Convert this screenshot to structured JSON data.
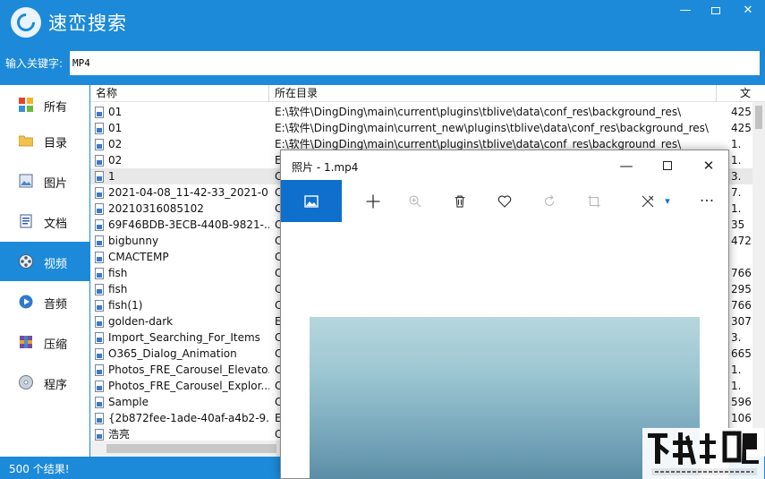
{
  "app": {
    "title": "速峦搜索",
    "window_buttons": {
      "minimize": "—",
      "close": "✕"
    }
  },
  "search": {
    "label": "输入关键字:",
    "value": "MP4"
  },
  "sidebar": {
    "items": [
      {
        "label": "所有",
        "icon": "grid-icon",
        "active": false
      },
      {
        "label": "目录",
        "icon": "folder-icon",
        "active": false
      },
      {
        "label": "图片",
        "icon": "picture-icon",
        "active": false
      },
      {
        "label": "文档",
        "icon": "document-icon",
        "active": false
      },
      {
        "label": "视频",
        "icon": "film-reel-icon",
        "active": true
      },
      {
        "label": "音频",
        "icon": "play-icon",
        "active": false
      },
      {
        "label": "压缩",
        "icon": "archive-icon",
        "active": false
      },
      {
        "label": "程序",
        "icon": "disc-icon",
        "active": false
      }
    ]
  },
  "list": {
    "columns": {
      "name": "名称",
      "dir": "所在目录",
      "size": "文"
    },
    "rows": [
      {
        "name": "01",
        "dir": "E:\\软件\\DingDing\\main\\current\\plugins\\tblive\\data\\conf_res\\background_res\\",
        "size": "425"
      },
      {
        "name": "01",
        "dir": "E:\\软件\\DingDing\\main\\current_new\\plugins\\tblive\\data\\conf_res\\background_res\\",
        "size": "425"
      },
      {
        "name": "02",
        "dir": "E:\\软件\\DingDing\\main\\current\\plugins\\tblive\\data\\conf_res\\background_res\\",
        "size": "1."
      },
      {
        "name": "02",
        "dir": "E:",
        "size": "1."
      },
      {
        "name": "1",
        "dir": "C",
        "size": "3."
      },
      {
        "name": "2021-04-08_11-42-33_2021-0...",
        "dir": "C",
        "size": "7."
      },
      {
        "name": "20210316085102",
        "dir": "C",
        "size": "1."
      },
      {
        "name": "69F46BDB-3ECB-440B-9821-...",
        "dir": "C",
        "size": "35"
      },
      {
        "name": "bigbunny",
        "dir": "C",
        "size": "472"
      },
      {
        "name": "CMACTEMP",
        "dir": "C",
        "size": ""
      },
      {
        "name": "fish",
        "dir": "C",
        "size": "766"
      },
      {
        "name": "fish",
        "dir": "C",
        "size": "295"
      },
      {
        "name": "fish(1)",
        "dir": "C",
        "size": "766"
      },
      {
        "name": "golden-dark",
        "dir": "E",
        "size": "307"
      },
      {
        "name": "Import_Searching_For_Items",
        "dir": "C",
        "size": "3."
      },
      {
        "name": "O365_Dialog_Animation",
        "dir": "C",
        "size": "665"
      },
      {
        "name": "Photos_FRE_Carousel_Elevato...",
        "dir": "C",
        "size": "1."
      },
      {
        "name": "Photos_FRE_Carousel_Explor...",
        "dir": "C",
        "size": "1."
      },
      {
        "name": "Sample",
        "dir": "C",
        "size": "596"
      },
      {
        "name": "{2b872fee-1ade-40af-a4b2-9...",
        "dir": "E",
        "size": "106"
      },
      {
        "name": "浩亮",
        "dir": "C",
        "size": "1"
      }
    ]
  },
  "status": {
    "text": "500 个结果!"
  },
  "photos_window": {
    "title": "照片 - 1.mp4",
    "buttons": {
      "minimize": "—",
      "close": "✕"
    },
    "toolbar": [
      {
        "name": "view-icon"
      },
      {
        "name": "add-icon"
      },
      {
        "name": "zoom-in-icon"
      },
      {
        "name": "delete-icon"
      },
      {
        "name": "favorite-icon"
      },
      {
        "name": "rotate-icon"
      },
      {
        "name": "crop-icon"
      },
      {
        "name": "edit-icon"
      },
      {
        "name": "more-icon"
      }
    ]
  },
  "colors": {
    "brand": "#1c8ad8",
    "photos_accent": "#0f6fcc"
  }
}
